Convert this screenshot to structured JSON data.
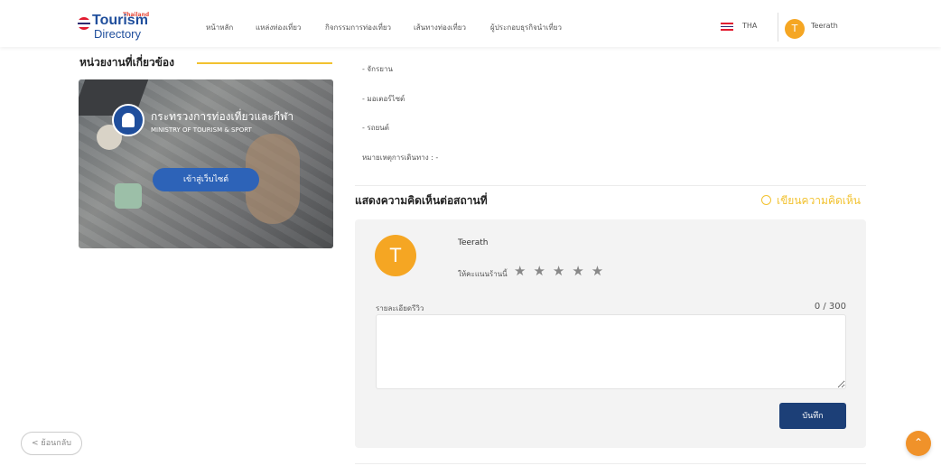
{
  "header": {
    "logo": {
      "top_text": "Thailand",
      "line1": "Tourism",
      "line2": "Directory"
    },
    "nav": [
      "หน้าหลัก",
      "แหล่งท่องเที่ยว",
      "กิจกรรมการท่องเที่ยว",
      "เส้นทางท่องเที่ยว",
      "ผู้ประกอบธุรกิจนำเที่ยว"
    ],
    "language": "THA",
    "user": {
      "initial": "T",
      "name": "Teerath"
    }
  },
  "sidebar": {
    "section_title": "หน่วยงานที่เกี่ยวข้อง",
    "banner": {
      "ministry_th": "กระทรวงการท่องเที่ยวและกีฬา",
      "ministry_en": "MINISTRY OF TOURISM & SPORT",
      "button_label": "เข้าสู่เว็บไซต์"
    }
  },
  "transport": {
    "items": [
      "- จักรยาน",
      "- มอเตอร์ไซต์",
      "- รถยนต์"
    ],
    "note": "หมายเหตุการเดินทาง : -"
  },
  "comments": {
    "heading": "แสดงความคิดเห็นต่อสถานที่",
    "write_label": "เขียนความคิดเห็น",
    "form": {
      "avatar_initial": "T",
      "user_name": "Teerath",
      "rating_label": "ให้คะแนนร้านนี้",
      "stars": "★★★★★",
      "rating_value": 0,
      "detail_label": "รายละเอียดรีวิว",
      "counter": "0 / 300",
      "textarea_value": "",
      "save_label": "บันทึก"
    }
  },
  "footer": {
    "back_label": "< ย้อนกลับ",
    "top_icon": "⌃"
  },
  "colors": {
    "accent_yellow": "#f2c230",
    "avatar_orange": "#f5a623",
    "save_navy": "#1c3f77",
    "banner_button_blue": "#2d63b8",
    "scroll_top_orange": "#f0922a"
  }
}
